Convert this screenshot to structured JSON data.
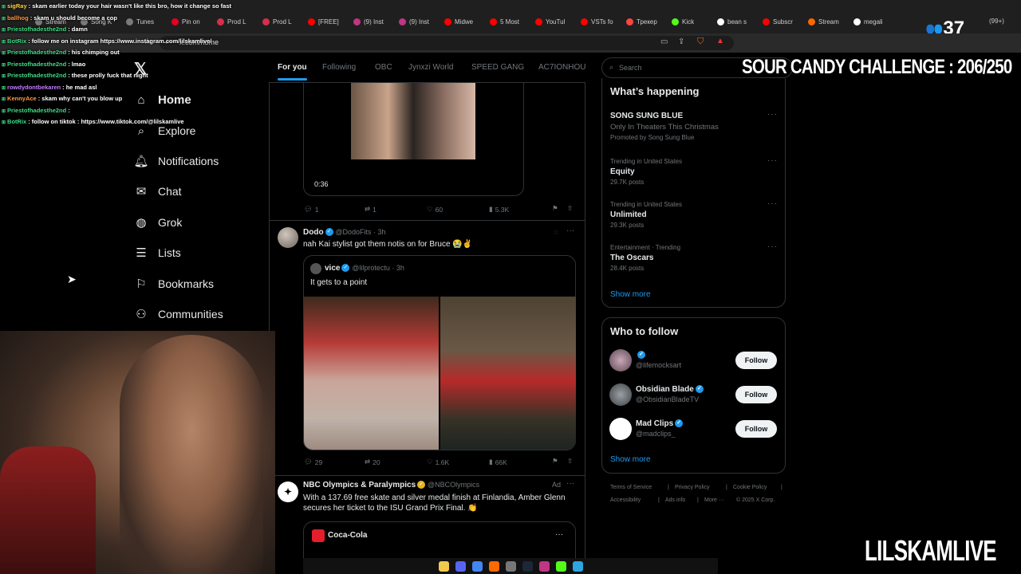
{
  "browser": {
    "url": "x.com/home",
    "tabs": [
      {
        "label": "Stream",
        "color": "#7a7a7a"
      },
      {
        "label": "Song K",
        "color": "#7a7a7a"
      },
      {
        "label": "Tunes",
        "color": "#7a7a7a"
      },
      {
        "label": "Pin on",
        "color": "#e60023"
      },
      {
        "label": "Prod L",
        "color": "#d62f4b"
      },
      {
        "label": "Prod L",
        "color": "#d62f4b"
      },
      {
        "label": "[FREE]",
        "color": "#ff0000"
      },
      {
        "label": "(9) Inst",
        "color": "#c13584"
      },
      {
        "label": "(9) Inst",
        "color": "#c13584"
      },
      {
        "label": "Midwe",
        "color": "#ff0000"
      },
      {
        "label": "5 Most",
        "color": "#ff0000"
      },
      {
        "label": "YouTul",
        "color": "#ff0000"
      },
      {
        "label": "VSTs fo",
        "color": "#ff0000"
      },
      {
        "label": "Трекер",
        "color": "#ff4444"
      },
      {
        "label": "Kick",
        "color": "#53fc18"
      },
      {
        "label": "bean s",
        "color": "#ffffff"
      },
      {
        "label": "Subscr",
        "color": "#ff0000"
      },
      {
        "label": "Stream",
        "color": "#ff6600"
      },
      {
        "label": "megali",
        "color": "#ffffff"
      }
    ],
    "tab_count": "(99+)",
    "viewers": "37"
  },
  "chat": [
    {
      "user": "sigRay",
      "color": "#ffd54a",
      "msg": ": skam earlier today your hair wasn't like this bro, how it change so fast"
    },
    {
      "user": "ballhog",
      "color": "#ff9a3c",
      "msg": ": skam u should become a cop"
    },
    {
      "user": "Priestofhadesthe2nd",
      "color": "#3ddc84",
      "msg": ": damn"
    },
    {
      "user": "BotRix",
      "color": "#3ddc84",
      "msg": ": follow me on instagram https://www.instagram.com/lilskamlive/"
    },
    {
      "user": "Priestofhadesthe2nd",
      "color": "#3ddc84",
      "msg": ": his chimping out"
    },
    {
      "user": "Priestofhadesthe2nd",
      "color": "#3ddc84",
      "msg": ": lmao"
    },
    {
      "user": "Priestofhadesthe2nd",
      "color": "#3ddc84",
      "msg": ": these prolly fuck that night"
    },
    {
      "user": "rowdydontbekaren",
      "color": "#c27cff",
      "msg": ": he mad asl"
    },
    {
      "user": "KennyAce",
      "color": "#ff9a3c",
      "msg": ": skam why can't you blow up"
    },
    {
      "user": "Priestofhadesthe2nd",
      "color": "#3ddc84",
      "msg": ":"
    },
    {
      "user": "BotRix",
      "color": "#3ddc84",
      "msg": ": follow on tiktok : https://www.tiktok.com/@lilskamlive"
    }
  ],
  "nav": {
    "items": [
      {
        "label": "Home",
        "icon": "home-icon"
      },
      {
        "label": "Explore",
        "icon": "search-icon"
      },
      {
        "label": "Notifications",
        "icon": "bell-icon"
      },
      {
        "label": "Chat",
        "icon": "chat-icon"
      },
      {
        "label": "Grok",
        "icon": "grok-icon"
      },
      {
        "label": "Lists",
        "icon": "list-icon"
      },
      {
        "label": "Bookmarks",
        "icon": "bookmark-icon"
      },
      {
        "label": "Communities",
        "icon": "communities-icon"
      }
    ]
  },
  "feed_tabs": [
    "For you",
    "Following",
    "OBC",
    "Jynxzi World",
    "SPEED GANG",
    "AC7IONHOU"
  ],
  "post1": {
    "duration": "0:36",
    "replies": "1",
    "reposts": "1",
    "likes": "60",
    "views": "5.3K"
  },
  "post2": {
    "name": "Dodo",
    "handle": "@DodoFits · 3h",
    "text": "nah Kai stylist got them notis on for Bruce 😭✌️",
    "quote_name": "vice",
    "quote_handle": "@lilprotectu · 3h",
    "quote_text": "It gets to a point",
    "replies": "29",
    "reposts": "20",
    "likes": "1.6K",
    "views": "66K"
  },
  "post3": {
    "name": "NBC Olympics & Paralympics",
    "handle": "@NBCOlympics",
    "ad_label": "Ad",
    "text1": "With a 137.69 free skate and silver medal finish at Finlandia, Amber Glenn",
    "text2": "secures her ticket to the ISU Grand Prix Final. 👏",
    "inner_name": "Coca-Cola"
  },
  "search": {
    "placeholder": "Search"
  },
  "happening": {
    "title": "What’s happening",
    "items": [
      {
        "meta": "",
        "name": "SONG SUNG BLUE",
        "sub": "Only In Theaters This Christmas",
        "promo": "Promoted by Song Sung Blue"
      },
      {
        "meta": "Trending in United States",
        "name": "Equity",
        "sub": "29.7K posts"
      },
      {
        "meta": "Trending in United States",
        "name": "Unlimited",
        "sub": "29.3K posts"
      },
      {
        "meta": "Entertainment · Trending",
        "name": "The Oscars",
        "sub": "28.4K posts"
      }
    ],
    "show_more": "Show more"
  },
  "who_to_follow": {
    "title": "Who to follow",
    "people": [
      {
        "name": "",
        "handle": "@lifemocksart"
      },
      {
        "name": "Obsidian Blade",
        "handle": "@ObsidianBladeTV"
      },
      {
        "name": "Mad Clips",
        "handle": "@madclips_"
      }
    ],
    "follow_label": "Follow",
    "show_more": "Show more"
  },
  "footer": {
    "l1": [
      "Terms of Service",
      "|",
      "Privacy Policy",
      "|",
      "Cookie Policy",
      "|"
    ],
    "l2": [
      "Accessibility",
      "|",
      "Ads info",
      "|",
      "More ···",
      "© 2025 X Corp."
    ]
  },
  "overlay": {
    "challenge": "SOUR CANDY CHALLENGE : 206/250",
    "brand": "LILSKAMLIVE"
  },
  "colors": {
    "accent": "#1d9bf0",
    "bg": "#000000",
    "muted": "#71767b"
  }
}
